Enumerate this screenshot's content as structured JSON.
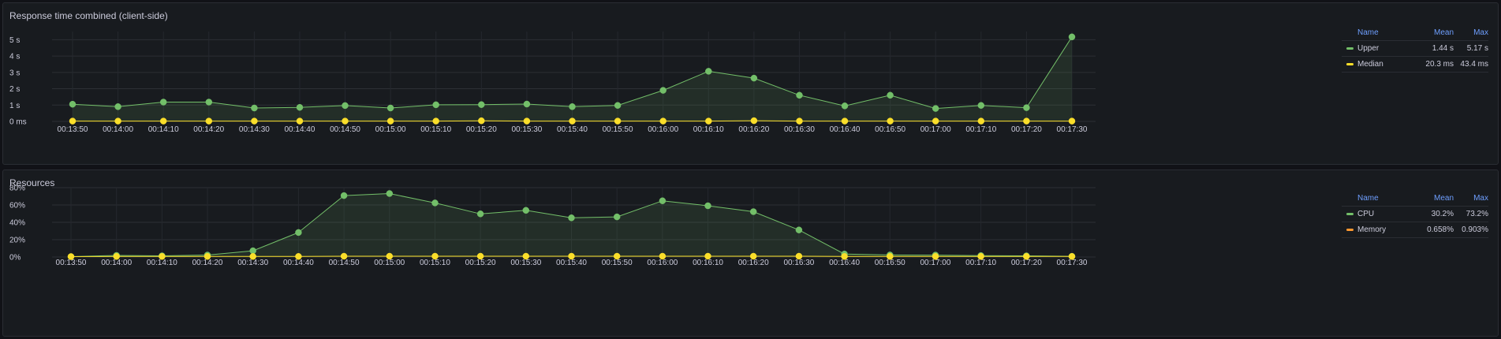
{
  "panels": [
    {
      "title": "Response time combined (client-side)",
      "legend": {
        "header": {
          "name": "Name",
          "mean": "Mean",
          "max": "Max"
        },
        "rows": [
          {
            "name": "Upper",
            "mean": "1.44 s",
            "max": "5.17 s",
            "color": "#73bf69"
          },
          {
            "name": "Median",
            "mean": "20.3 ms",
            "max": "43.4 ms",
            "color": "#fade2a"
          }
        ]
      }
    },
    {
      "title": "Resources",
      "legend": {
        "header": {
          "name": "Name",
          "mean": "Mean",
          "max": "Max"
        },
        "rows": [
          {
            "name": "CPU",
            "mean": "30.2%",
            "max": "73.2%",
            "color": "#73bf69"
          },
          {
            "name": "Memory",
            "mean": "0.658%",
            "max": "0.903%",
            "color": "#fade2a"
          }
        ]
      }
    }
  ],
  "chart_data": [
    {
      "type": "line",
      "title": "Response time combined (client-side)",
      "x": [
        "00:13:50",
        "00:14:00",
        "00:14:10",
        "00:14:20",
        "00:14:30",
        "00:14:40",
        "00:14:50",
        "00:15:00",
        "00:15:10",
        "00:15:20",
        "00:15:30",
        "00:15:40",
        "00:15:50",
        "00:16:00",
        "00:16:10",
        "00:16:20",
        "00:16:30",
        "00:16:40",
        "00:16:50",
        "00:17:00",
        "00:17:10",
        "00:17:20",
        "00:17:30"
      ],
      "y_ticks": [
        "0 ms",
        "1 s",
        "2 s",
        "3 s",
        "4 s",
        "5 s"
      ],
      "ylim": [
        0,
        5.5
      ],
      "y_unit": "s",
      "grid": true,
      "legend_placement": "right",
      "series": [
        {
          "name": "Upper",
          "color": "#73bf69",
          "fill": true,
          "values": [
            1.05,
            0.9,
            1.18,
            1.18,
            0.82,
            0.86,
            0.97,
            0.82,
            1.02,
            1.03,
            1.06,
            0.9,
            0.98,
            1.9,
            3.07,
            2.65,
            1.6,
            0.95,
            1.6,
            0.79,
            0.98,
            0.84,
            5.17
          ]
        },
        {
          "name": "Median",
          "color": "#fade2a",
          "fill": false,
          "values": [
            0.018,
            0.018,
            0.019,
            0.02,
            0.018,
            0.019,
            0.019,
            0.019,
            0.02,
            0.04,
            0.02,
            0.02,
            0.02,
            0.02,
            0.02,
            0.043,
            0.02,
            0.02,
            0.02,
            0.02,
            0.02,
            0.02,
            0.02
          ]
        }
      ]
    },
    {
      "type": "line",
      "title": "Resources",
      "x": [
        "00:13:50",
        "00:14:00",
        "00:14:10",
        "00:14:20",
        "00:14:30",
        "00:14:40",
        "00:14:50",
        "00:15:00",
        "00:15:10",
        "00:15:20",
        "00:15:30",
        "00:15:40",
        "00:15:50",
        "00:16:00",
        "00:16:10",
        "00:16:20",
        "00:16:30",
        "00:16:40",
        "00:16:50",
        "00:17:00",
        "00:17:10",
        "00:17:20",
        "00:17:30"
      ],
      "y_ticks": [
        "0%",
        "20%",
        "40%",
        "60%",
        "80%"
      ],
      "ylim": [
        0,
        80
      ],
      "y_unit": "%",
      "grid": true,
      "legend_placement": "right",
      "series": [
        {
          "name": "CPU",
          "color": "#73bf69",
          "fill": true,
          "values": [
            0.5,
            1.8,
            1.4,
            2.3,
            7.2,
            28.3,
            70.8,
            73.2,
            62.4,
            49.7,
            53.8,
            45.2,
            46.3,
            64.8,
            59.1,
            52.3,
            31.2,
            3.5,
            2.4,
            2.2,
            1.6,
            1.4,
            0.8
          ]
        },
        {
          "name": "Memory",
          "color": "#fade2a",
          "fill": false,
          "values": [
            0.5,
            0.6,
            0.6,
            0.6,
            0.6,
            0.6,
            0.9,
            0.9,
            0.9,
            0.9,
            0.9,
            0.9,
            0.9,
            0.9,
            0.9,
            0.9,
            0.9,
            0.6,
            0.6,
            0.6,
            0.6,
            0.6,
            0.6
          ]
        }
      ]
    }
  ]
}
